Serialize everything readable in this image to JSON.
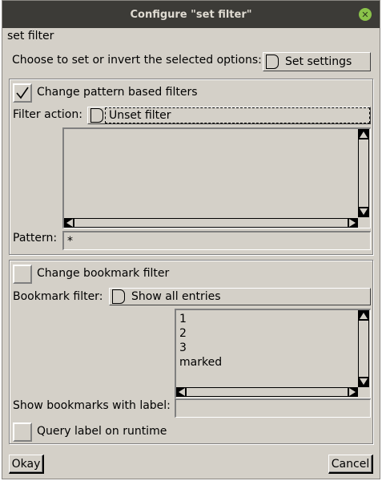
{
  "window": {
    "title": "Configure \"set filter\""
  },
  "header": {
    "name": "set filter"
  },
  "top": {
    "choose_label": "Choose to set or invert the selected options:",
    "settings_value": "Set settings"
  },
  "pattern_group": {
    "checkbox_label": "Change pattern based filters",
    "checked": true,
    "action_label": "Filter action:",
    "action_value": "Unset filter",
    "pattern_label": "Pattern:",
    "pattern_value": "*"
  },
  "bookmark_group": {
    "checkbox_label": "Change bookmark filter",
    "checked": false,
    "filter_label": "Bookmark filter:",
    "filter_value": "Show all entries",
    "items": [
      "1",
      "2",
      "3",
      "marked"
    ],
    "show_label": "Show bookmarks with label:",
    "show_value": "",
    "query_label": "Query label on runtime",
    "query_checked": false
  },
  "buttons": {
    "okay": "Okay",
    "cancel": "Cancel"
  },
  "colors": {
    "titlebar": "#3c3b37",
    "dialog": "#d4d0c8",
    "close": "#8ac34a"
  }
}
